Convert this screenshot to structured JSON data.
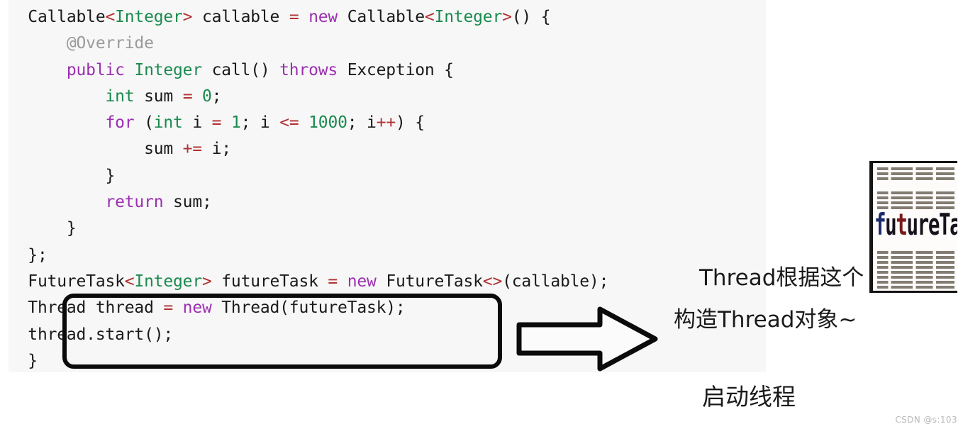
{
  "code": {
    "language": "java",
    "background_color": "#f7f7f7",
    "lines": [
      {
        "id": "line-1",
        "indent": 0,
        "tokens": [
          {
            "t": "Callable",
            "c": "id"
          },
          {
            "t": "<",
            "c": "op"
          },
          {
            "t": "Integer",
            "c": "type"
          },
          {
            "t": ">",
            "c": "op"
          },
          {
            "t": " callable ",
            "c": "id"
          },
          {
            "t": "=",
            "c": "op"
          },
          {
            "t": " ",
            "c": "id"
          },
          {
            "t": "new",
            "c": "kw"
          },
          {
            "t": " Callable",
            "c": "id"
          },
          {
            "t": "<",
            "c": "op"
          },
          {
            "t": "Integer",
            "c": "type"
          },
          {
            "t": ">",
            "c": "op"
          },
          {
            "t": "() {",
            "c": "punc"
          }
        ]
      },
      {
        "id": "line-2",
        "indent": 1,
        "tokens": [
          {
            "t": "@Override",
            "c": "anno"
          }
        ]
      },
      {
        "id": "line-3",
        "indent": 1,
        "tokens": [
          {
            "t": "public",
            "c": "kw"
          },
          {
            "t": " ",
            "c": "id"
          },
          {
            "t": "Integer",
            "c": "type"
          },
          {
            "t": " call() ",
            "c": "id"
          },
          {
            "t": "throws",
            "c": "kw"
          },
          {
            "t": " Exception {",
            "c": "id"
          }
        ]
      },
      {
        "id": "line-4",
        "indent": 2,
        "tokens": [
          {
            "t": "int",
            "c": "type"
          },
          {
            "t": " sum ",
            "c": "id"
          },
          {
            "t": "=",
            "c": "op"
          },
          {
            "t": " ",
            "c": "id"
          },
          {
            "t": "0",
            "c": "num"
          },
          {
            "t": ";",
            "c": "punc"
          }
        ]
      },
      {
        "id": "line-5",
        "indent": 2,
        "tokens": [
          {
            "t": "for",
            "c": "kw"
          },
          {
            "t": " (",
            "c": "punc"
          },
          {
            "t": "int",
            "c": "type"
          },
          {
            "t": " i ",
            "c": "id"
          },
          {
            "t": "=",
            "c": "op"
          },
          {
            "t": " ",
            "c": "id"
          },
          {
            "t": "1",
            "c": "num"
          },
          {
            "t": "; i ",
            "c": "id"
          },
          {
            "t": "<=",
            "c": "op"
          },
          {
            "t": " ",
            "c": "id"
          },
          {
            "t": "1000",
            "c": "num"
          },
          {
            "t": "; i",
            "c": "id"
          },
          {
            "t": "++",
            "c": "op"
          },
          {
            "t": ") {",
            "c": "punc"
          }
        ]
      },
      {
        "id": "line-6",
        "indent": 3,
        "tokens": [
          {
            "t": "sum ",
            "c": "id"
          },
          {
            "t": "+=",
            "c": "op"
          },
          {
            "t": " i;",
            "c": "id"
          }
        ]
      },
      {
        "id": "line-7",
        "indent": 2,
        "tokens": [
          {
            "t": "}",
            "c": "punc"
          }
        ]
      },
      {
        "id": "line-8",
        "indent": 2,
        "tokens": [
          {
            "t": "return",
            "c": "kw"
          },
          {
            "t": " sum;",
            "c": "id"
          }
        ]
      },
      {
        "id": "line-9",
        "indent": 1,
        "tokens": [
          {
            "t": "}",
            "c": "punc"
          }
        ]
      },
      {
        "id": "line-10",
        "indent": 0,
        "tokens": [
          {
            "t": "};",
            "c": "punc"
          }
        ]
      },
      {
        "id": "line-11",
        "indent": 0,
        "tokens": [
          {
            "t": "FutureTask",
            "c": "id"
          },
          {
            "t": "<",
            "c": "op"
          },
          {
            "t": "Integer",
            "c": "type"
          },
          {
            "t": ">",
            "c": "op"
          },
          {
            "t": " futureTask ",
            "c": "id"
          },
          {
            "t": "=",
            "c": "op"
          },
          {
            "t": " ",
            "c": "id"
          },
          {
            "t": "new",
            "c": "kw"
          },
          {
            "t": " FutureTask",
            "c": "id"
          },
          {
            "t": "<>",
            "c": "op"
          },
          {
            "t": "(callable);",
            "c": "id"
          }
        ]
      },
      {
        "id": "line-12",
        "indent": 0,
        "highlighted": true,
        "tokens": [
          {
            "t": "Thread thread ",
            "c": "id"
          },
          {
            "t": "=",
            "c": "op"
          },
          {
            "t": " ",
            "c": "id"
          },
          {
            "t": "new",
            "c": "kw"
          },
          {
            "t": " Thread(futureTask);",
            "c": "id"
          }
        ]
      },
      {
        "id": "line-13",
        "indent": 0,
        "highlighted": true,
        "tokens": [
          {
            "t": "thread.start();",
            "c": "id"
          }
        ]
      },
      {
        "id": "line-14",
        "indent": -1,
        "tokens": [
          {
            "t": "}",
            "c": "punc"
          }
        ]
      }
    ],
    "plain_text": "Callable<Integer> callable = new Callable<Integer>() {\n    @Override\n    public Integer call() throws Exception {\n        int sum = 0;\n        for (int i = 1; i <= 1000; i++) {\n            sum += i;\n        }\n        return sum;\n    }\n};\nFutureTask<Integer> futureTask = new FutureTask<>(callable);\nThread thread = new Thread(futureTask);\nthread.start();\n}",
    "syntax_colors": {
      "keyword": "#9b30b0",
      "type": "#1a8a4e",
      "number": "#1a8a4e",
      "operator": "#b03030",
      "identifier": "#1a1a1a",
      "annotation": "#9a9a9a"
    }
  },
  "highlight": {
    "label": "thread-creation-highlight",
    "border_color": "#0b0b0b"
  },
  "arrow": {
    "label": "right-arrow",
    "direction": "right",
    "stroke_color": "#0b0b0b"
  },
  "annotations": {
    "note_line_1": "Thread根据这个",
    "note_line_2": "构造Thread对象~",
    "note_bottom": "启动线程"
  },
  "receipt_photo": {
    "label": "futureTask 便签照片",
    "word": "futureTask",
    "frame_color": "#141414",
    "paper_color": "#fdfcfa"
  },
  "watermark": {
    "text": "CSDN @s:103"
  }
}
